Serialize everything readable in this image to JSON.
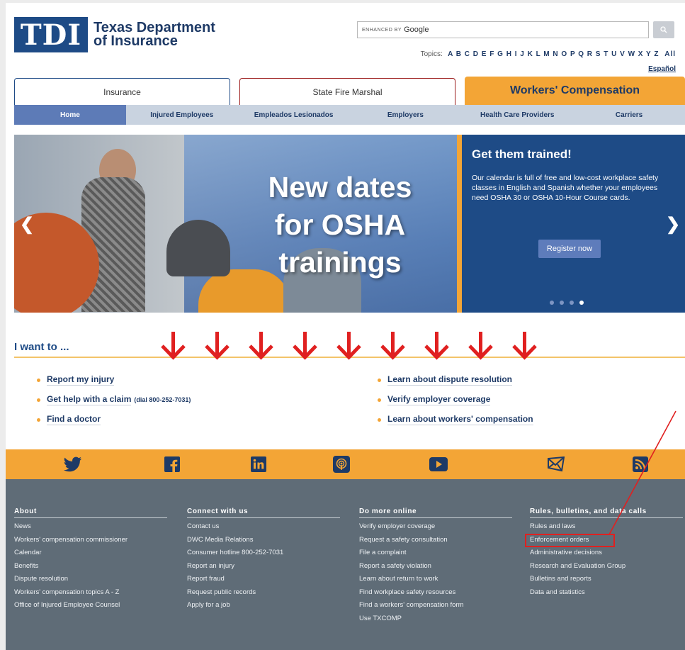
{
  "header": {
    "logo_mark": "TDI",
    "logo_line1": "Texas Department",
    "logo_line2": "of Insurance",
    "search_enhanced": "ENHANCED BY",
    "search_google": "Google",
    "topics_label": "Topics:",
    "topics_letters": "A B C D E F G H I J K L M N O P Q R S T U V W X Y Z",
    "topics_all": "All",
    "espanol": "Español"
  },
  "tabs": [
    {
      "label": "Insurance"
    },
    {
      "label": "State Fire Marshal"
    },
    {
      "label": "Workers' Compensation"
    }
  ],
  "subnav": [
    "Home",
    "Injured Employees",
    "Empleados Lesionados",
    "Employers",
    "Health Care Providers",
    "Carriers"
  ],
  "hero": {
    "line1": "New dates",
    "line2": "for OSHA",
    "line3": "trainings",
    "promo_title": "Get them trained!",
    "promo_text": "Our calendar is full of free and low-cost workplace safety classes in English and Spanish whether your employees need OSHA 30 or OSHA 10-Hour Course cards.",
    "promo_button": "Register now",
    "slide_count": 4,
    "active_slide": 4
  },
  "iwant": {
    "title": "I want to ...",
    "left": [
      {
        "label": "Report my injury",
        "note": ""
      },
      {
        "label": "Get help with a claim",
        "note": "(dial 800-252-7031)"
      },
      {
        "label": "Find a doctor",
        "note": ""
      }
    ],
    "right": [
      {
        "label": "Learn about dispute resolution"
      },
      {
        "label": "Verify employer coverage"
      },
      {
        "label": "Learn about workers' compensation"
      }
    ]
  },
  "social": [
    "twitter-icon",
    "facebook-icon",
    "linkedin-icon",
    "podcast-icon",
    "youtube-icon",
    "email-icon",
    "rss-icon"
  ],
  "footer": {
    "about": {
      "title": "About",
      "links": [
        "News",
        "Workers' compensation commissioner",
        "Calendar",
        "Benefits",
        "Dispute resolution",
        "Workers' compensation topics A - Z",
        "Office of Injured Employee Counsel"
      ]
    },
    "connect": {
      "title": "Connect with us",
      "links": [
        "Contact us",
        "DWC Media Relations",
        "Consumer hotline 800-252-7031",
        "Report an injury",
        "Report fraud",
        "Request public records",
        "Apply for a job"
      ]
    },
    "online": {
      "title": "Do more online",
      "links": [
        "Verify employer coverage",
        "Request a safety consultation",
        "File a complaint",
        "Report a safety violation",
        "Learn about return to work",
        "Find workplace safety resources",
        "Find a workers' compensation form",
        "Use TXCOMP"
      ]
    },
    "rules": {
      "title": "Rules, bulletins, and data calls",
      "links": [
        "Rules and laws",
        "Enforcement orders",
        "Administrative decisions",
        "Research and Evaluation Group",
        "Bulletins and reports",
        "Data and statistics"
      ]
    }
  },
  "colors": {
    "brand_blue": "#1e4b86",
    "accent_orange": "#f3a536",
    "footer_gray": "#5f6c77",
    "annotation_red": "#e02020"
  }
}
